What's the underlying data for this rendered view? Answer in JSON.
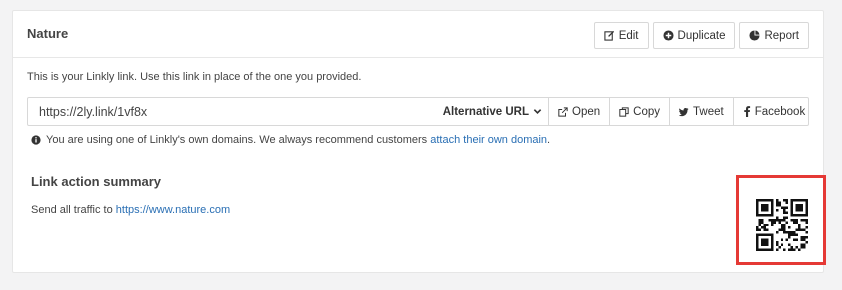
{
  "panel": {
    "title": "Nature",
    "buttons": {
      "edit": "Edit",
      "duplicate": "Duplicate",
      "report": "Report"
    }
  },
  "intro": "This is your Linkly link. Use this link in place of the one you provided.",
  "linkbar": {
    "url": "https://2ly.link/1vf8x",
    "alt_url_label": "Alternative URL",
    "open": "Open",
    "copy": "Copy",
    "tweet": "Tweet",
    "facebook": "Facebook"
  },
  "notice": {
    "text": "You are using one of Linkly's own domains. We always recommend customers",
    "link": "attach their own domain",
    "end": "."
  },
  "summary": {
    "title": "Link action summary",
    "prefix": "Send all traffic to",
    "target": "https://www.nature.com"
  },
  "icons": [
    "edit-icon",
    "plus-circle-icon",
    "pie-chart-icon",
    "chevron-down-icon",
    "external-link-icon",
    "copy-icon",
    "twitter-icon",
    "facebook-icon",
    "info-icon",
    "qr-code"
  ],
  "colors": {
    "link": "#2a6fb4",
    "highlight": "#e53935"
  }
}
